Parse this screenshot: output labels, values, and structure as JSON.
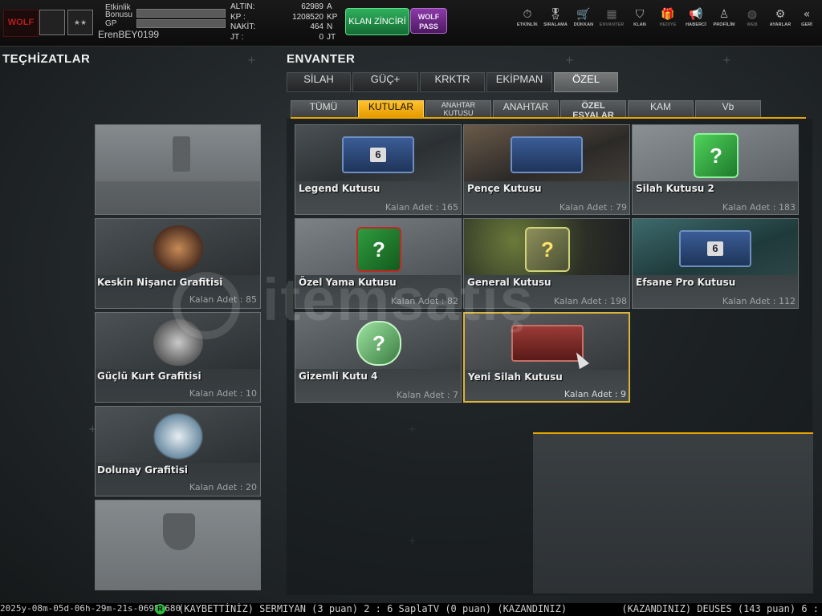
{
  "player": {
    "logo_text": "WOLF",
    "logo_subtext": "DIRILIS",
    "rank_label": "★★",
    "etkinlik_label": "Etkinlik",
    "bonus_label": "Bonusu",
    "gp_label": "GP",
    "username": "ErenBEY0199"
  },
  "currencies": [
    {
      "label": "ALTIN:",
      "value": "62989",
      "unit": "A"
    },
    {
      "label": "KP  :",
      "value": "1208520",
      "unit": "KP"
    },
    {
      "label": "NAKİT:",
      "value": "464",
      "unit": "N"
    },
    {
      "label": "JT   :",
      "value": "0",
      "unit": "JT"
    }
  ],
  "buttons": {
    "klan_zinciri": "KLAN ZİNCİRİ",
    "wolf_pass_1": "WOLF",
    "wolf_pass_2": "PASS"
  },
  "nav": [
    {
      "label": "ETKİNLİK",
      "icon": "stopwatch-icon"
    },
    {
      "label": "SIRALAMA",
      "icon": "medal-icon"
    },
    {
      "label": "DÜKKAN",
      "icon": "cart-icon"
    },
    {
      "label": "ENVANTER",
      "icon": "inventory-icon"
    },
    {
      "label": "KLAN",
      "icon": "shield-icon"
    },
    {
      "label": "HEDİYE",
      "icon": "gift-icon"
    },
    {
      "label": "HABERCİ",
      "icon": "megaphone-icon"
    },
    {
      "label": "PROFİLİM",
      "icon": "profile-icon"
    },
    {
      "label": "WEB",
      "icon": "globe-icon"
    },
    {
      "label": "AYARLAR",
      "icon": "gear-icon"
    },
    {
      "label": "GERİ",
      "icon": "back-chevron-icon"
    }
  ],
  "sections": {
    "left_title": "TEÇHİZATLAR",
    "right_title": "ENVANTER"
  },
  "tabs": [
    "SİLAH",
    "GÜÇ+",
    "KRKTR",
    "EKİPMAN",
    "ÖZEL"
  ],
  "active_tab": "ÖZEL",
  "subtabs": [
    "TÜMÜ",
    "KUTULAR",
    "ANAHTAR KUTUSU",
    "ANAHTAR",
    "ÖZEL EŞYALAR",
    "KAM",
    "Vb"
  ],
  "active_subtab": "KUTULAR",
  "equipment": [
    {
      "name": "",
      "count": "",
      "kind": "spray"
    },
    {
      "name": "Keskin Nişancı Grafitisi",
      "count": "Kalan Adet : 85",
      "kind": "figure"
    },
    {
      "name": "Güçlü Kurt Grafitisi",
      "count": "Kalan Adet : 10",
      "kind": "figure"
    },
    {
      "name": "Dolunay Grafitisi",
      "count": "Kalan Adet : 20",
      "kind": "figure"
    },
    {
      "name": "",
      "count": "",
      "kind": "shield"
    }
  ],
  "inventory": [
    {
      "name": "Legend Kutusu",
      "count": "Kalan Adet : 165",
      "art": "crate-blue-6"
    },
    {
      "name": "Pençe Kutusu",
      "count": "Kalan Adet : 79",
      "art": "crate-blue"
    },
    {
      "name": "Silah Kutusu 2",
      "count": "Kalan Adet : 183",
      "art": "cube-green"
    },
    {
      "name": "Özel Yama Kutusu",
      "count": "Kalan Adet : 82",
      "art": "cube-gift"
    },
    {
      "name": "General Kutusu",
      "count": "Kalan Adet : 198",
      "art": "cube-gold"
    },
    {
      "name": "Efsane Pro Kutusu",
      "count": "Kalan Adet : 112",
      "art": "crate-blue-6"
    },
    {
      "name": "Gizemli Kutu 4",
      "count": "Kalan Adet : 7",
      "art": "cube-mystery"
    },
    {
      "name": "Yeni Silah Kutusu",
      "count": "Kalan Adet : 9",
      "art": "crate-red"
    }
  ],
  "selected_item": "Yeni Silah Kutusu",
  "ticker": {
    "timestamp": "2025y-08m-05d-06h-29m-21s-0698-680",
    "icon_label": "R",
    "message_left": "(KAYBETTİNİZ) SERMIYAN (3 puan) 2 : 6 SaplaTV (0 puan) (KAZANDINIZ)",
    "message_right": "(KAZANDINIZ) DEUSES (143 puan) 6 :"
  },
  "watermark": "itemsatış",
  "colors": {
    "accent": "#e6a400",
    "klan_button": "#2fb05c",
    "wolf_pass": "#8b3aa6"
  }
}
